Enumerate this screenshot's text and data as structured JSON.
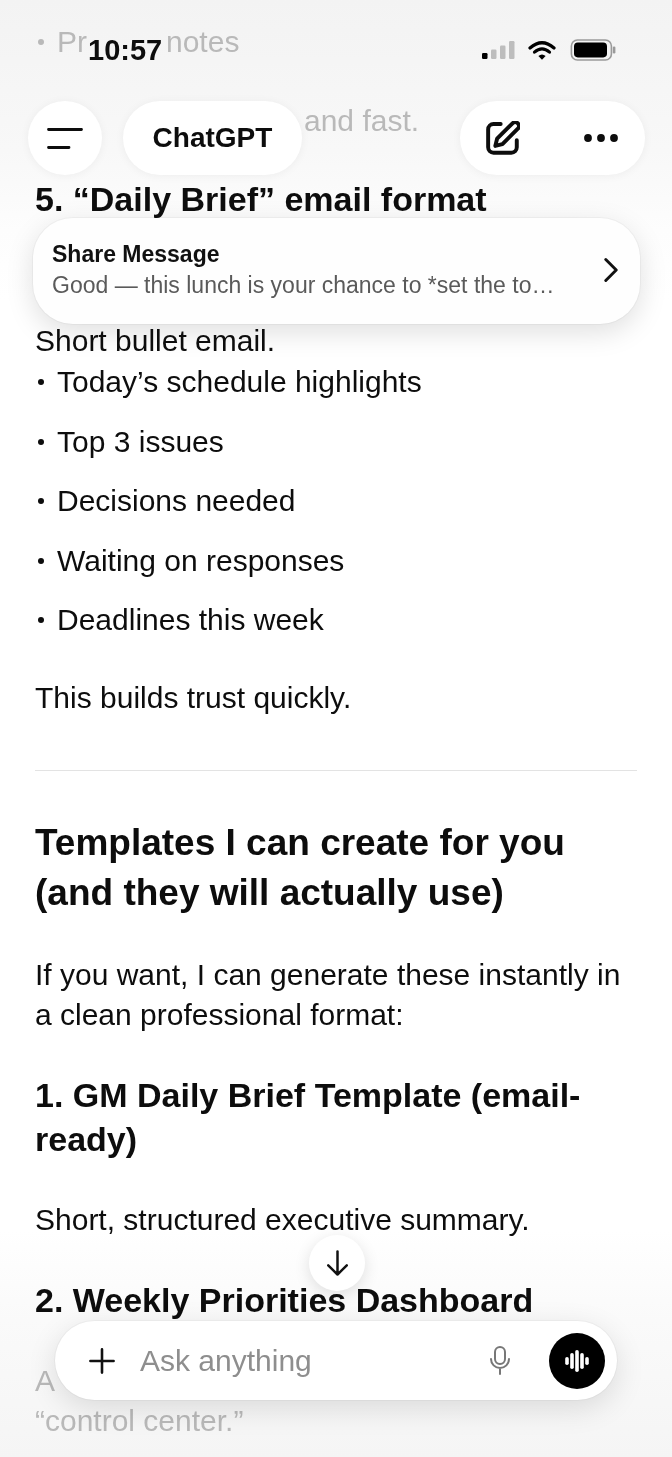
{
  "status_bar": {
    "time": "10:57"
  },
  "header": {
    "title": "ChatGPT"
  },
  "conversation": {
    "above_banner": [
      {
        "kind": "bullet_fragment",
        "parts": [
          "Pr",
          "notes"
        ],
        "faded": true
      },
      {
        "kind": "line_tail",
        "text": "and fast.",
        "faded": true
      },
      {
        "kind": "subheading",
        "text": "5. “Daily Brief” email format",
        "faded": false
      }
    ],
    "below_banner": [
      {
        "kind": "paragraph",
        "text": "Short bullet email.",
        "faded": false
      },
      {
        "kind": "bullet",
        "text": "Today’s schedule highlights",
        "faded": false
      },
      {
        "kind": "bullet",
        "text": "Top 3 issues",
        "faded": false
      },
      {
        "kind": "bullet",
        "text": "Decisions needed",
        "faded": false
      },
      {
        "kind": "bullet",
        "text": "Waiting on responses",
        "faded": false
      },
      {
        "kind": "bullet",
        "text": "Deadlines this week",
        "faded": false
      },
      {
        "kind": "paragraph",
        "text": "This builds trust quickly.",
        "faded": false
      },
      {
        "kind": "divider",
        "faded": false
      },
      {
        "kind": "heading",
        "text": "Templates I can create for you (and they will actually use)",
        "faded": false
      },
      {
        "kind": "paragraph",
        "text": "If you want, I can generate these instantly in a clean professional format:",
        "faded": false
      },
      {
        "kind": "subheading",
        "text": "1. GM Daily Brief Template (email-ready)",
        "faded": false
      },
      {
        "kind": "paragraph",
        "text": "Short, structured executive summary.",
        "faded": false
      },
      {
        "kind": "subheading",
        "text": "2. Weekly Priorities Dashboard",
        "faded": false
      },
      {
        "kind": "line_head",
        "text": "A",
        "faded": true
      },
      {
        "kind": "paragraph",
        "text": "“control center.”",
        "faded": true
      }
    ]
  },
  "share_banner": {
    "title": "Share Message",
    "message": "Good — this lunch is your chance to *set the to…"
  },
  "composer": {
    "placeholder": "Ask anything"
  }
}
